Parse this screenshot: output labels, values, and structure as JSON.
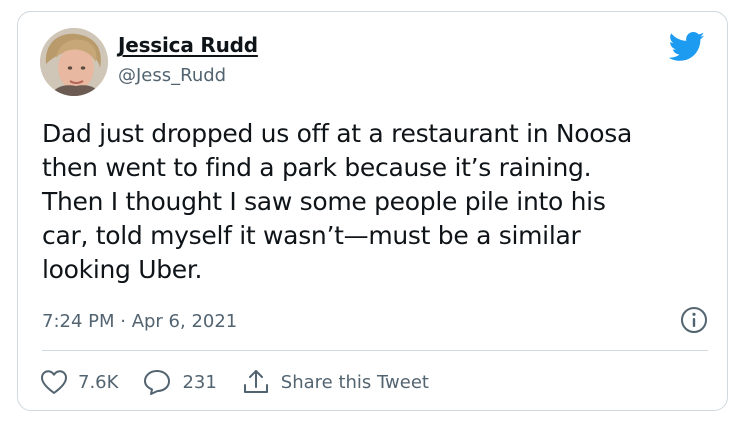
{
  "author": {
    "name": "Jessica Rudd",
    "handle": "@Jess_Rudd"
  },
  "tweet": {
    "lines": [
      "Dad just dropped us off at a restaurant in Noosa",
      "then went to find a park because it’s raining.",
      "Then I thought I saw some people pile into his",
      "car, told myself it wasn’t—must be a similar",
      "looking Uber."
    ],
    "timestamp": "7:24 PM · Apr 6, 2021"
  },
  "actions": {
    "likes": "7.6K",
    "replies": "231",
    "share_label": "Share this Tweet"
  },
  "icons": {
    "brand": "twitter-bird-icon",
    "info": "info-icon",
    "like": "heart-icon",
    "reply": "speech-bubble-icon",
    "share": "share-arrow-icon"
  },
  "colors": {
    "brand": "#1d9bf0",
    "text": "#0f1419",
    "secondary": "#536471",
    "border": "#cfd9de"
  }
}
